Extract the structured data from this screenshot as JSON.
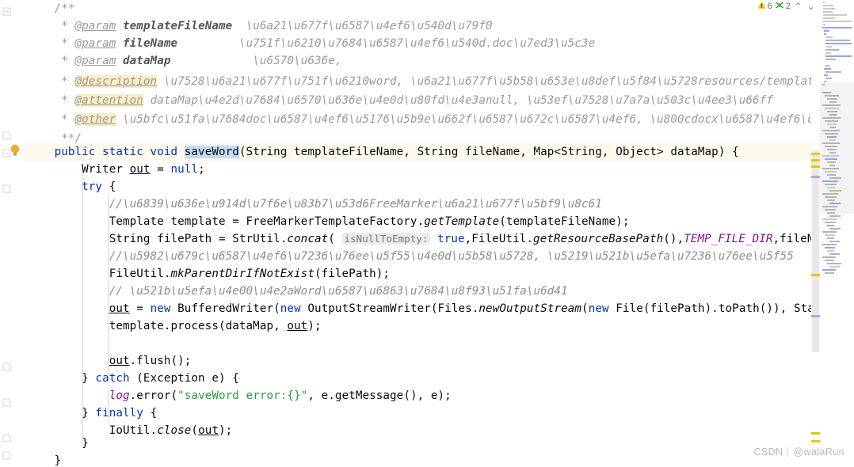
{
  "editor": {
    "language": "Java",
    "current_line_index": 8,
    "watermark": {
      "site": "CSDN",
      "user": "@walaRun"
    },
    "inspections": {
      "warning_icon": "warning-triangle-icon",
      "warning_count": "6",
      "weak_warning_icon": "weak-warning-icon",
      "weak_warning_count": "2",
      "prev_icon": "chevron-up-icon",
      "next_icon": "chevron-down-icon",
      "prev_glyph": "⌃",
      "next_glyph": "⌄"
    },
    "gutter": {
      "intention_icon": "lightbulb-icon",
      "fold_icon": "code-fold-icon"
    },
    "lines": [
      {
        "n": 1,
        "indent": 0,
        "text": "/**"
      },
      {
        "n": 2,
        "indent": 0,
        "text": " * @param templateFileName  模板文件名称"
      },
      {
        "n": 3,
        "indent": 0,
        "text": " * @param fileName         生成的文件名.doc结尾"
      },
      {
        "n": 4,
        "indent": 0,
        "text": " * @param dataMap            数据,"
      },
      {
        "n": 5,
        "indent": 0,
        "text": " * @description 用模板生成word, 模板存放路径在resources/template下,生成的文件路径在jar包的同级目录/tmp路径下"
      },
      {
        "n": 6,
        "indent": 0,
        "text": " * @attention dataMap中的数据不能为null, 可用空值代替"
      },
      {
        "n": 7,
        "indent": 0,
        "text": " * @other 导出的doc文件其实是文本文件, 而docx文件是二进制文件(其实是一个压缩包).关于如何导出docx可参考 https://blog.csdn.net/wantLight/ar"
      },
      {
        "n": 8,
        "indent": 0,
        "text": " **/"
      },
      {
        "n": 9,
        "indent": 0,
        "text": "public static void saveWord(String templateFileName, String fileName, Map<String, Object> dataMap) {"
      },
      {
        "n": 10,
        "indent": 1,
        "text": "Writer out = null;"
      },
      {
        "n": 11,
        "indent": 1,
        "text": "try {"
      },
      {
        "n": 12,
        "indent": 2,
        "text": "//根据配置获取FreeMarker模板对象"
      },
      {
        "n": 13,
        "indent": 2,
        "text": "Template template = FreeMarkerTemplateFactory.getTemplate(templateFileName);"
      },
      {
        "n": 14,
        "indent": 2,
        "text": "String filePath = StrUtil.concat( isNullToEmpty: true,FileUtil.getResourceBasePath(),TEMP_FILE_DIR,fileName);"
      },
      {
        "n": 15,
        "indent": 2,
        "text": "//如果文件父目录不存在, 则创建父目录"
      },
      {
        "n": 16,
        "indent": 2,
        "text": "FileUtil.mkParentDirIfNotExist(filePath);"
      },
      {
        "n": 17,
        "indent": 2,
        "text": "// 创建一个Word文档的输出流"
      },
      {
        "n": 18,
        "indent": 2,
        "text": "out = new BufferedWriter(new OutputStreamWriter(Files.newOutputStream(new File(filePath).toPath()), StandardCharse"
      },
      {
        "n": 19,
        "indent": 2,
        "text": "template.process(dataMap, out);"
      },
      {
        "n": 20,
        "indent": 2,
        "text": ""
      },
      {
        "n": 21,
        "indent": 2,
        "text": "out.flush();"
      },
      {
        "n": 22,
        "indent": 1,
        "text": "} catch (Exception e) {"
      },
      {
        "n": 23,
        "indent": 2,
        "text": "log.error(\"saveWord error:{}\", e.getMessage(), e);"
      },
      {
        "n": 24,
        "indent": 1,
        "text": "} finally {"
      },
      {
        "n": 25,
        "indent": 2,
        "text": "IoUtil.close(out);"
      },
      {
        "n": 26,
        "indent": 1,
        "text": "}"
      },
      {
        "n": 27,
        "indent": 0,
        "text": "}"
      }
    ],
    "inline_hints": [
      {
        "label": "isNullToEmpty:",
        "line": 14
      }
    ],
    "highlighted_identifier": "saveWord",
    "colors": {
      "keyword": "#0033b3",
      "string": "#2a9d3f",
      "comment": "#8c8c8c",
      "static_field": "#871094",
      "number": "#1750eb",
      "current_line_bg": "#fcf9ed",
      "identifier_highlight_bg": "#c3dcf7",
      "doc_tag_highlight_bg": "#f7eec4",
      "warning_marker": "#e8c800",
      "weak_warning_marker": "#b9a0e8"
    }
  }
}
